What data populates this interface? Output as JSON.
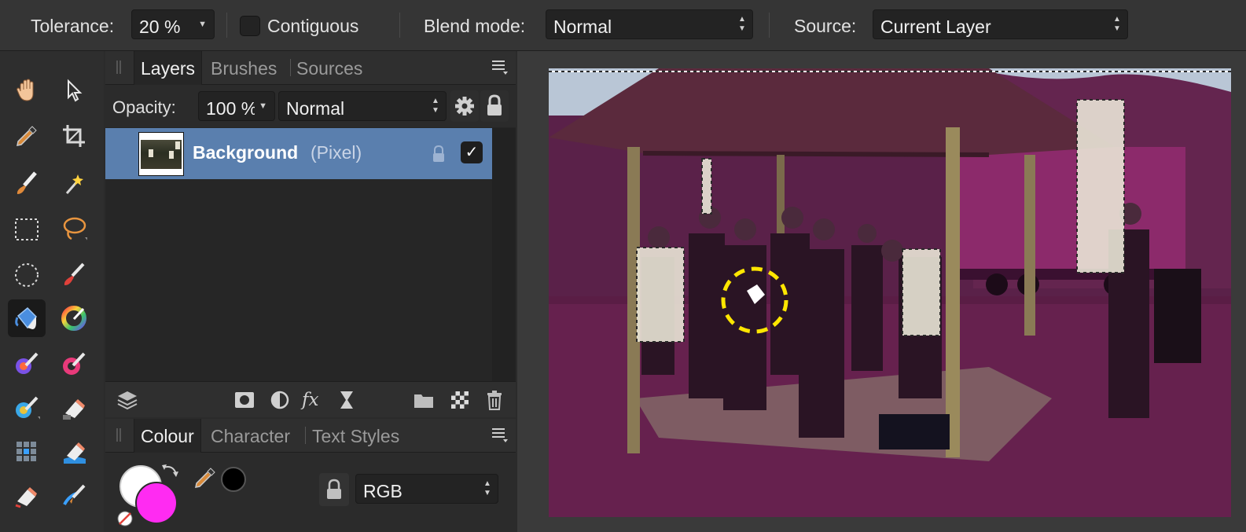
{
  "toolbar": {
    "tolerance_label": "Tolerance:",
    "tolerance_value": "20 %",
    "contiguous_label": "Contiguous",
    "blend_label": "Blend mode:",
    "blend_value": "Normal",
    "source_label": "Source:",
    "source_value": "Current Layer"
  },
  "tools": [
    {
      "name": "view-tool",
      "icon": "hand-icon"
    },
    {
      "name": "move-tool",
      "icon": "pointer-icon"
    },
    {
      "name": "color-picker-tool",
      "icon": "eyedropper-icon"
    },
    {
      "name": "crop-tool",
      "icon": "crop-icon"
    },
    {
      "name": "selection-brush-tool",
      "icon": "selection-brush-icon"
    },
    {
      "name": "flood-select-tool",
      "icon": "magic-wand-icon"
    },
    {
      "name": "rectangular-marquee-tool",
      "icon": "rect-marquee-icon"
    },
    {
      "name": "freehand-selection-tool",
      "icon": "lasso-icon"
    },
    {
      "name": "elliptical-marquee-tool",
      "icon": "ellipse-marquee-icon"
    },
    {
      "name": "paint-brush-tool",
      "icon": "paintbrush-icon"
    },
    {
      "name": "flood-fill-tool",
      "icon": "paint-bucket-icon"
    },
    {
      "name": "gradient-tool",
      "icon": "color-wheel-icon"
    },
    {
      "name": "pixel-tool",
      "icon": "color-brush-icon"
    },
    {
      "name": "paint-mixer-tool",
      "icon": "mixer-brush-icon"
    },
    {
      "name": "color-replacement-tool",
      "icon": "replace-brush-icon"
    },
    {
      "name": "erase-tool",
      "icon": "eraser-icon"
    },
    {
      "name": "grid-tool",
      "icon": "grid-icon"
    },
    {
      "name": "background-erase-tool",
      "icon": "background-eraser-icon"
    },
    {
      "name": "flood-erase-tool",
      "icon": "flood-eraser-icon"
    },
    {
      "name": "smudge-tool",
      "icon": "smudge-icon"
    }
  ],
  "layers_panel": {
    "tabs": [
      "Layers",
      "Brushes",
      "Sources"
    ],
    "active_tab": "Layers",
    "opacity_label": "Opacity:",
    "opacity_value": "100 %",
    "blend_value": "Normal",
    "layer": {
      "name": "Background",
      "type": "(Pixel)",
      "visible": "✓"
    },
    "footer_icons": [
      "layers-icon",
      "mask-icon",
      "adjustment-icon",
      "fx-icon",
      "live-filter-icon",
      "folder-icon",
      "checker-icon",
      "trash-icon"
    ]
  },
  "colour_panel": {
    "tabs": [
      "Colour",
      "Character",
      "Text Styles"
    ],
    "active_tab": "Colour",
    "mode_value": "RGB",
    "primary_color": "#ffffff",
    "secondary_color": "#ff2bf2",
    "picked_color": "#000000"
  },
  "colors": {
    "accent_selection": "#5a7fae",
    "overlay_magenta": "#b0207f",
    "fill_cursor": "#ffe600"
  }
}
